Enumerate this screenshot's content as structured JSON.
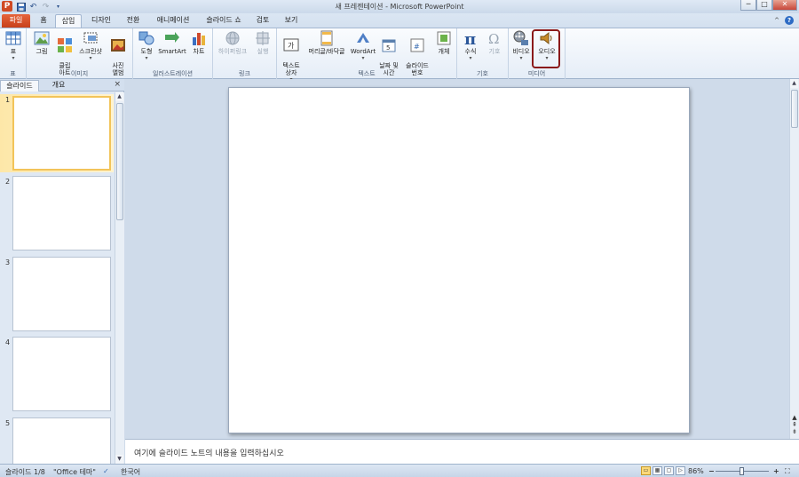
{
  "titlebar": {
    "app_icon": "P",
    "title": "새 프레젠테이션 - Microsoft PowerPoint",
    "qat": [
      "save-icon",
      "undo-icon",
      "redo-icon",
      "customize-icon"
    ],
    "controls": {
      "minimize": "─",
      "maximize": "□",
      "close": "✕"
    }
  },
  "tabs": {
    "file": "파일",
    "home": "홈",
    "insert": "삽입",
    "design": "디자인",
    "transitions": "전환",
    "animations": "애니메이션",
    "slideshow": "슬라이드 쇼",
    "review": "검토",
    "view": "보기",
    "active": "삽입"
  },
  "ribbon": {
    "groups": {
      "table": "표",
      "images": "이미지",
      "illustrations": "일러스트레이션",
      "links": "링크",
      "text": "텍스트",
      "symbols": "기호",
      "media": "미디어"
    },
    "buttons": {
      "table": "표",
      "picture": "그림",
      "clipart": "클립\n아트",
      "screenshot": "스크린샷",
      "photo_album": "사진\n앨범",
      "shapes": "도형",
      "smartart": "SmartArt",
      "chart": "차트",
      "hyperlink": "하이퍼링크",
      "action": "실행",
      "textbox": "텍스트\n상자",
      "header_footer": "머리글/바닥글",
      "wordart": "WordArt",
      "datetime": "날짜 및\n시간",
      "slide_number": "슬라이드\n번호",
      "object": "개체",
      "equation": "수식",
      "symbol": "기호",
      "video": "비디오",
      "audio": "오디오"
    },
    "dropdown_marker": "▾"
  },
  "left_panel": {
    "tab_slides": "슬라이드",
    "tab_outline": "개요",
    "close": "×",
    "thumbnails": [
      {
        "num": "1",
        "selected": true
      },
      {
        "num": "2",
        "selected": false
      },
      {
        "num": "3",
        "selected": false
      },
      {
        "num": "4",
        "selected": false
      },
      {
        "num": "5",
        "selected": false
      }
    ]
  },
  "notes": {
    "placeholder": "여기에 슬라이드 노트의 내용을 입력하십시오"
  },
  "statusbar": {
    "slide_info": "슬라이드 1/8",
    "theme": "\"Office 테마\"",
    "language": "한국어",
    "zoom": "86%",
    "zoom_minus": "−",
    "zoom_plus": "+"
  },
  "colors": {
    "file_tab": "#d35226",
    "accent": "#2b579a",
    "highlight": "#8b1a1a",
    "selection": "#f2c45a"
  }
}
